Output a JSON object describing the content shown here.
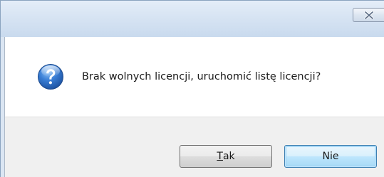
{
  "dialog": {
    "title": "",
    "close_icon": "close-x-icon",
    "icon": "question-icon",
    "message": "Brak wolnych licencji, uruchomić listę licencji?",
    "buttons": {
      "yes": {
        "mnemonic": "T",
        "rest": "ak"
      },
      "no": {
        "label": "Nie"
      }
    },
    "colors": {
      "icon_blue": "#2f6ec1",
      "default_button_border": "#3c7fb1"
    }
  }
}
